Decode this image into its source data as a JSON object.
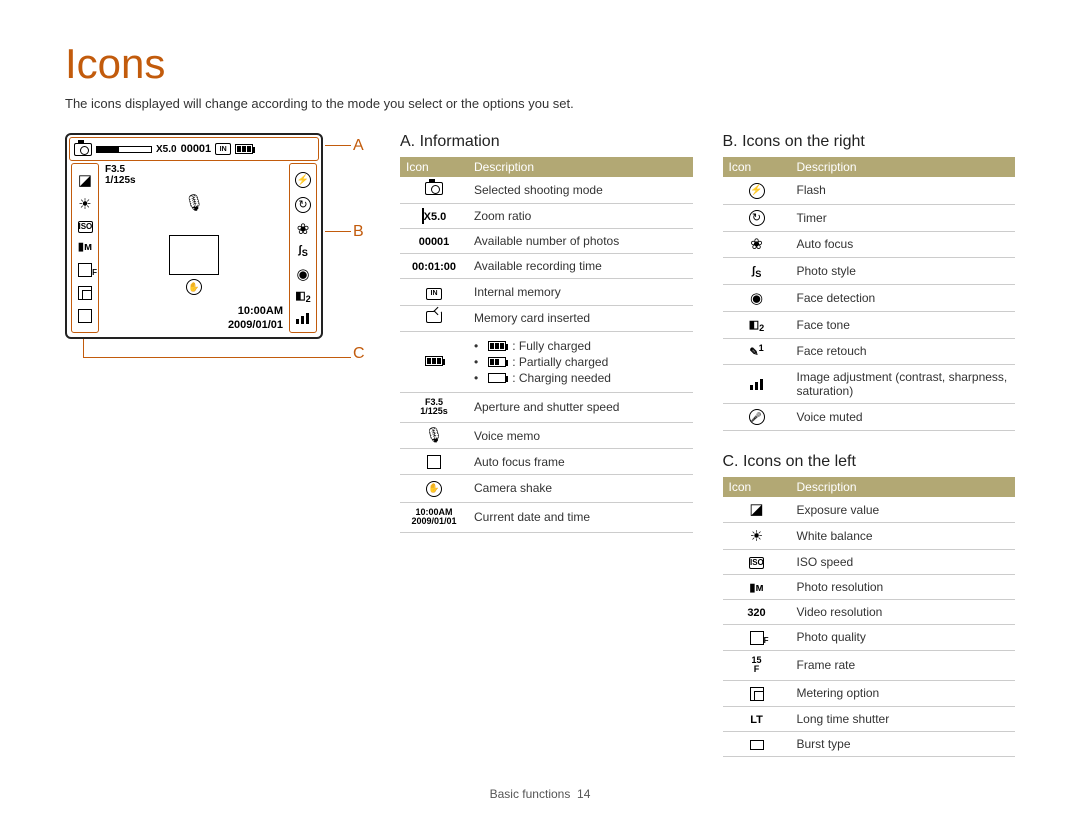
{
  "page_title": "Icons",
  "intro_text": "The icons displayed will change according to the mode you select or the options you set.",
  "labels": {
    "A": "A",
    "B": "B",
    "C": "C"
  },
  "lcd": {
    "zoom_label": "X5.0",
    "counter": "00001",
    "aperture": "F3.5",
    "shutter": "1/125s",
    "time": "10:00AM",
    "date": "2009/01/01"
  },
  "section_a": {
    "heading": "A. Information",
    "header_icon": "Icon",
    "header_desc": "Description",
    "rows": [
      {
        "icon_text": "",
        "icon_name": "camera-mode-icon",
        "desc": "Selected shooting mode"
      },
      {
        "icon_text": "X5.0",
        "icon_name": "zoom-bar-icon",
        "desc": "Zoom ratio"
      },
      {
        "icon_text": "00001",
        "icon_name": "counter-icon",
        "desc": "Available number of photos"
      },
      {
        "icon_text": "00:01:00",
        "icon_name": "rec-time-icon",
        "desc": "Available recording time"
      },
      {
        "icon_text": "IN",
        "icon_name": "internal-memory-icon",
        "desc": "Internal memory"
      },
      {
        "icon_text": "",
        "icon_name": "memory-card-icon",
        "desc": "Memory card inserted"
      },
      {
        "icon_text": "",
        "icon_name": "battery-icon",
        "desc_bullets": [
          {
            "label": ": Fully charged",
            "state": "full"
          },
          {
            "label": ": Partially charged",
            "state": "partial"
          },
          {
            "label": ": Charging needed",
            "state": "empty"
          }
        ]
      },
      {
        "icon_text": "F3.5\n1/125s",
        "icon_name": "aperture-shutter-icon",
        "desc": "Aperture and shutter speed"
      },
      {
        "icon_text": "🎙",
        "icon_name": "voice-memo-icon",
        "desc": "Voice memo"
      },
      {
        "icon_text": "",
        "icon_name": "af-frame-icon",
        "desc": "Auto focus frame"
      },
      {
        "icon_text": "",
        "icon_name": "camera-shake-icon",
        "desc": "Camera shake"
      },
      {
        "icon_text": "10:00 AM\n2009/01/01",
        "icon_name": "datetime-icon",
        "desc": "Current date and time"
      }
    ]
  },
  "section_b": {
    "heading": "B. Icons on the right",
    "header_icon": "Icon",
    "header_desc": "Description",
    "rows": [
      {
        "icon_name": "flash-icon",
        "glyph": "⚡",
        "desc": "Flash"
      },
      {
        "icon_name": "timer-icon",
        "glyph": "↻",
        "desc": "Timer"
      },
      {
        "icon_name": "auto-focus-icon",
        "glyph": "❀",
        "desc": "Auto focus"
      },
      {
        "icon_name": "photo-style-icon",
        "glyph": "ʃS",
        "desc": "Photo style"
      },
      {
        "icon_name": "face-detection-icon",
        "glyph": "◉",
        "desc": "Face detection"
      },
      {
        "icon_name": "face-tone-icon",
        "glyph": "◧₂",
        "desc": "Face tone"
      },
      {
        "icon_name": "face-retouch-icon",
        "glyph": "✎¹",
        "desc": "Face retouch"
      },
      {
        "icon_name": "image-adjust-icon",
        "glyph": "▥",
        "desc": "Image adjustment (contrast, sharpness, saturation)"
      },
      {
        "icon_name": "voice-muted-icon",
        "glyph": "🎤⃠",
        "desc": "Voice muted"
      }
    ]
  },
  "section_c": {
    "heading": "C. Icons on the left",
    "header_icon": "Icon",
    "header_desc": "Description",
    "rows": [
      {
        "icon_name": "exposure-value-icon",
        "glyph": "☑±",
        "desc": "Exposure value"
      },
      {
        "icon_name": "white-balance-icon",
        "glyph": "☀",
        "desc": "White balance"
      },
      {
        "icon_name": "iso-speed-icon",
        "glyph": "ISO",
        "desc": "ISO speed"
      },
      {
        "icon_name": "photo-resolution-icon",
        "glyph": "▮M",
        "desc": "Photo resolution"
      },
      {
        "icon_name": "video-resolution-icon",
        "glyph": "320",
        "desc": "Video resolution"
      },
      {
        "icon_name": "photo-quality-icon",
        "glyph": "▦F",
        "desc": "Photo quality"
      },
      {
        "icon_name": "frame-rate-icon",
        "glyph": "15\nF",
        "desc": "Frame rate"
      },
      {
        "icon_name": "metering-icon",
        "glyph": "[•]",
        "desc": "Metering option"
      },
      {
        "icon_name": "long-time-shutter-icon",
        "glyph": "LT",
        "desc": "Long time shutter"
      },
      {
        "icon_name": "burst-type-icon",
        "glyph": "▭",
        "desc": "Burst type"
      }
    ]
  },
  "footer": {
    "section": "Basic functions",
    "page": "14"
  }
}
